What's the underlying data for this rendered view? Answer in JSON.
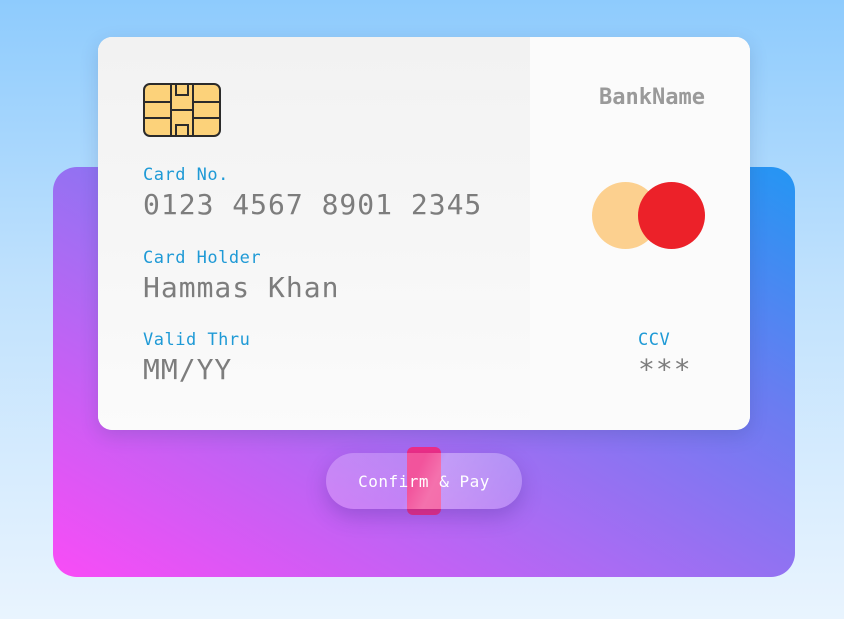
{
  "card": {
    "bank_name": "BankName",
    "card_number_label": "Card No.",
    "card_number": "0123 4567 8901 2345",
    "holder_label": "Card Holder",
    "holder_name": "Hammas Khan",
    "expiry_label": "Valid Thru",
    "expiry": "MM/YY",
    "ccv_label": "CCV",
    "ccv": "***",
    "chip_icon": "card-chip-icon",
    "network_icon": "mastercard-logo-icon"
  },
  "button": {
    "confirm_label": "Confirm & Pay"
  },
  "colors": {
    "label_blue": "#1f9ad6",
    "value_gray": "#7d7d7d",
    "logo_left": "#fcd08f",
    "logo_right": "#ec2129",
    "button_accent": "#ef2e86"
  }
}
